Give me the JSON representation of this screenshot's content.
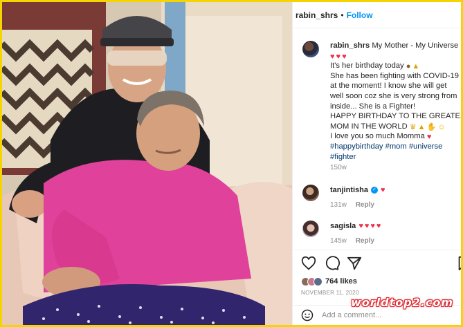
{
  "header": {
    "username": "rabin_shrs",
    "separator": "•",
    "follow_label": "Follow"
  },
  "caption": {
    "username": "rabin_shrs",
    "lines": [
      "My Mother - My Universe",
      "It's her birthday today",
      "She has been fighting with COVID-19",
      "at the moment! I know she will get",
      "well soon coz she is very strong from",
      "inside... She is a Fighter!",
      "HAPPY BIRTHDAY TO THE GREATEST",
      "MOM IN THE WORLD",
      "I love you so much Momma"
    ],
    "hashtags": [
      "#happybirthday",
      "#mom",
      "#universe",
      "#fighter"
    ],
    "time": "150w"
  },
  "comments": [
    {
      "username": "tanjintisha",
      "time": "131w",
      "reply_label": "Reply"
    },
    {
      "username": "sagisla",
      "time": "145w",
      "reply_label": "Reply"
    }
  ],
  "actions": {
    "likes_count": "764 likes",
    "date": "NOVEMBER 11, 2020"
  },
  "add_comment": {
    "placeholder": "Add a comment..."
  },
  "watermark": "worldtop2.com",
  "colors": {
    "follow": "#0095f6",
    "heart": "#ed2f4a",
    "hashtag": "#00376b",
    "frame_border": "#f5d400"
  },
  "icons": [
    "heart-icon",
    "comment-icon",
    "share-icon",
    "save-icon",
    "emoji-icon",
    "verified-icon"
  ]
}
